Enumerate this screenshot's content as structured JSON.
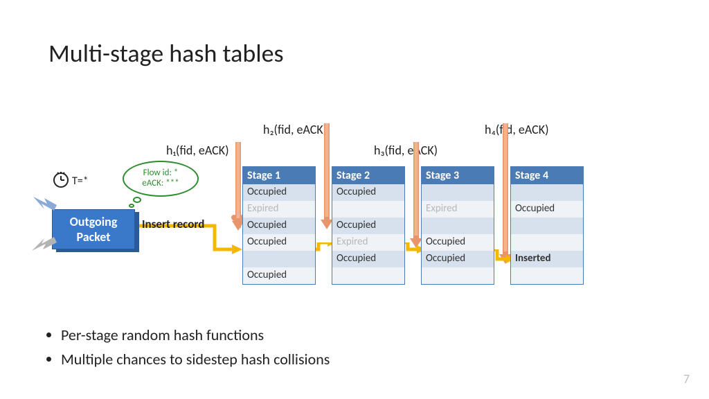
{
  "title": "Multi-stage hash tables",
  "page": "7",
  "packet": {
    "line1": "Outgoing",
    "line2": "Packet"
  },
  "tstar": "T=*",
  "bubble": {
    "line1": "Flow id: *",
    "line2": "eACK: ***"
  },
  "insert_label": "Insert record",
  "hash_labels": {
    "h1": "h₁(fid, eACK)",
    "h2": "h₂(fid, eACK)",
    "h3": "h₃(fid, eACK)",
    "h4": "h₄(fid, eACK)"
  },
  "stages": [
    {
      "header": "Stage 1",
      "rows": [
        "Occupied",
        "Expired",
        "Occupied",
        "Occupied",
        "",
        "Occupied"
      ]
    },
    {
      "header": "Stage 2",
      "rows": [
        "Occupied",
        "",
        "Occupied",
        "Expired",
        "Occupied",
        ""
      ]
    },
    {
      "header": "Stage 3",
      "rows": [
        "",
        "Expired",
        "",
        "Occupied",
        "Occupied",
        ""
      ]
    },
    {
      "header": "Stage 4",
      "rows": [
        "",
        "Occupied",
        "",
        "",
        "Inserted",
        ""
      ]
    }
  ],
  "bullets": [
    "Per-stage random hash functions",
    "Multiple chances to sidestep hash collisions"
  ]
}
